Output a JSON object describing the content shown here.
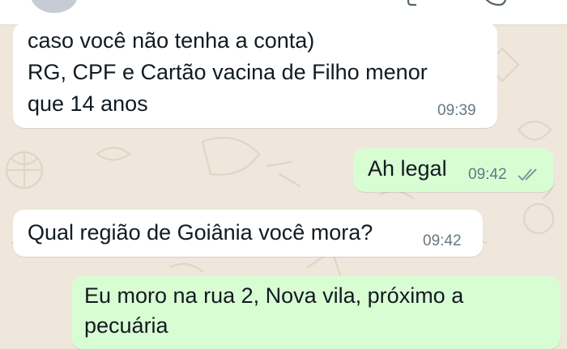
{
  "messages": [
    {
      "id": "m1",
      "direction": "incoming",
      "lines": [
        "caso você não tenha a conta)",
        "RG, CPF e Cartão vacina de Filho menor",
        "que 14 anos"
      ],
      "time": "09:39"
    },
    {
      "id": "m2",
      "direction": "outgoing",
      "lines": [
        "Ah legal"
      ],
      "time": "09:42",
      "status": "read-double-check-icon"
    },
    {
      "id": "m3",
      "direction": "incoming",
      "lines": [
        "Qual região de Goiânia você mora?"
      ],
      "time": "09:42"
    },
    {
      "id": "m4",
      "direction": "outgoing",
      "lines": [
        "Eu moro na rua 2, Nova vila, próximo a",
        "pecuária"
      ],
      "time": ""
    }
  ],
  "colors": {
    "wallpaper": "#efe7dc",
    "incoming": "#ffffff",
    "outgoing": "#d9fdd3",
    "text": "#111b21",
    "meta": "#667781",
    "read_check": "#8696a0"
  },
  "icons": [
    "avatar",
    "phone-icon",
    "video-call-icon",
    "double-check-icon"
  ]
}
